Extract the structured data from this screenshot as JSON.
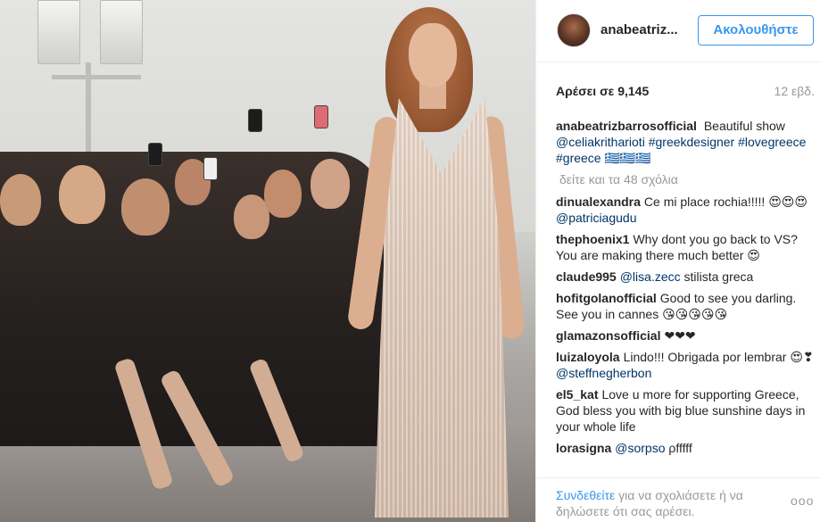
{
  "photo": {
    "alt_icon": "fashion-show-photo"
  },
  "header": {
    "username": "anabeatriz...",
    "follow_label": "Ακολουθήστε",
    "accent_color": "#3897f0"
  },
  "stats": {
    "likes": "Αρέσει σε 9,145",
    "time_ago": "12 εβδ."
  },
  "caption": {
    "author": "anabeatrizbarrosofficial",
    "text_1": " Beautiful show ",
    "mention_1": "@celiakritharioti",
    "text_2": " ",
    "tag_1": "#greekdesigner",
    "text_3": " ",
    "tag_2": "#lovegreece",
    "text_4": " ",
    "tag_3": "#greece",
    "text_5": " 🇬🇷🇬🇷🇬🇷"
  },
  "load_more": "δείτε και τα 48 σχόλια",
  "comments": [
    {
      "author": "dinualexandra",
      "text": "Ce mi place rochia!!!!! 😍😍😍 ",
      "mention": "@patriciagudu",
      "tail": ""
    },
    {
      "author": "thephoenix1",
      "text": "Why dont you go back to VS? You are making there much better 😍",
      "mention": "",
      "tail": ""
    },
    {
      "author": "claude995",
      "text": "",
      "mention": "@lisa.zecc",
      "tail": " stilista greca"
    },
    {
      "author": "hofitgolanofficial",
      "text": "Good to see you darling. See you in cannes 😘😘😘😘😘",
      "mention": "",
      "tail": ""
    },
    {
      "author": "glamazonsofficial",
      "text": "❤❤❤",
      "mention": "",
      "tail": ""
    },
    {
      "author": "luizaloyola",
      "text": "Lindo!!! Obrigada por lembrar 😍❣ ",
      "mention": "@steffnegherbon",
      "tail": ""
    },
    {
      "author": "el5_kat",
      "text": "Love u more for supporting Greece, God bless you with big blue sunshine days in your whole life",
      "mention": "",
      "tail": ""
    },
    {
      "author": "lorasigna",
      "text": "",
      "mention": "@sorpso",
      "tail": " ρfffff"
    }
  ],
  "footer": {
    "login_link": "Συνδεθείτε",
    "login_rest": " για να σχολιάσετε ή να δηλώσετε ότι σας αρέσει.",
    "more_label": "ooo"
  }
}
